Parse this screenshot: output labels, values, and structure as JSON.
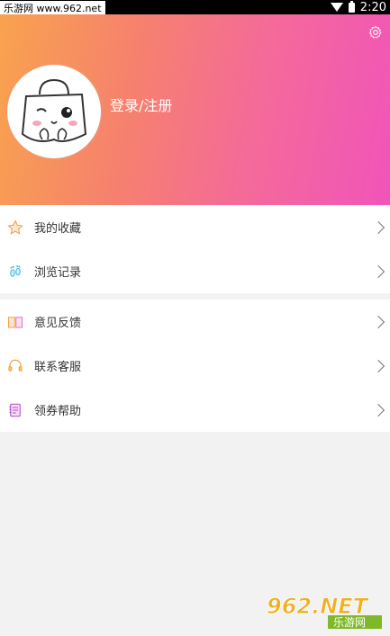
{
  "status": {
    "time": "2:20"
  },
  "watermark_top": "乐游网 www.962.net",
  "header": {
    "login_label": "登录/注册"
  },
  "menu_group_1": [
    {
      "label": "我的收藏",
      "icon": "star-icon"
    },
    {
      "label": "浏览记录",
      "icon": "footprint-icon"
    }
  ],
  "menu_group_2": [
    {
      "label": "意见反馈",
      "icon": "book-icon"
    },
    {
      "label": "联系客服",
      "icon": "headset-icon"
    },
    {
      "label": "领券帮助",
      "icon": "notebook-icon"
    }
  ],
  "watermark_logo": {
    "main": "962.NET",
    "sub": "乐游网"
  },
  "colors": {
    "gradient_start": "#f8a34e",
    "gradient_end": "#f154b9"
  }
}
